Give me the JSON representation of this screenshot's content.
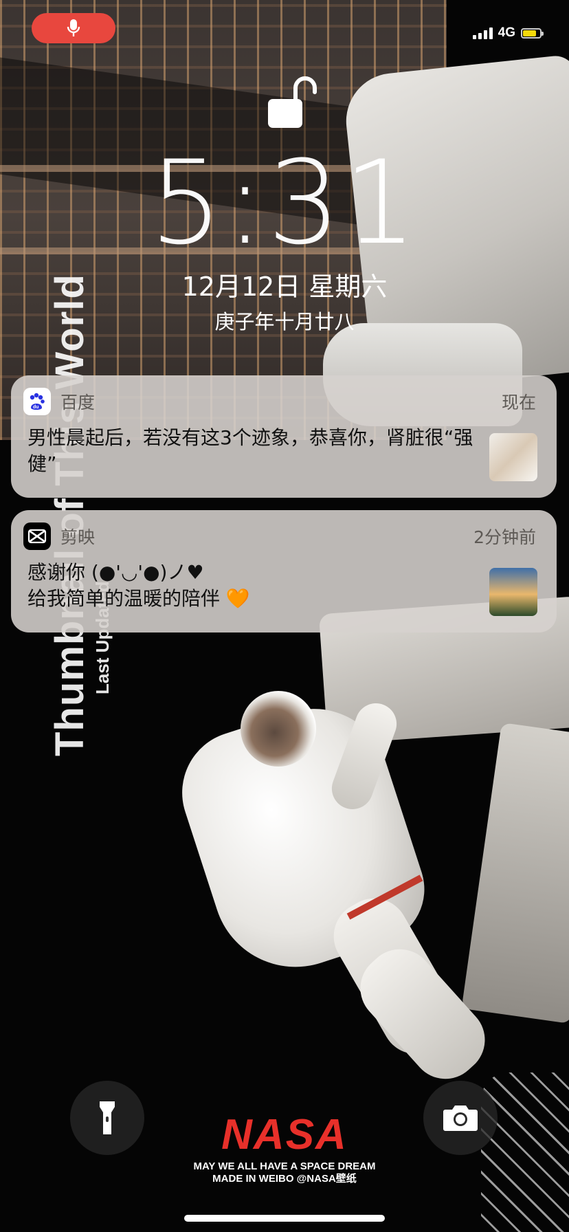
{
  "status_bar": {
    "mic_pill_color": "#e8473e",
    "mic_icon": "microphone-icon",
    "network": "4G",
    "signal_bars": 4,
    "battery_color": "#f5d90a",
    "battery_level": 0.8
  },
  "lock_screen": {
    "lock_icon": "unlocked-padlock-icon",
    "time": "5:31",
    "date": "12月12日 星期六",
    "lunar_date": "庚子年十月廿八"
  },
  "notifications": [
    {
      "app": "百度",
      "app_icon": "baidu-paw-icon",
      "app_icon_color": "#2932e1",
      "time": "现在",
      "body": "男性晨起后，若没有这3个迹象，恭喜你，肾脏很“强健”",
      "has_thumbnail": true
    },
    {
      "app": "剪映",
      "app_icon": "capcut-icon",
      "time": "2分钟前",
      "line1": "感谢你 (●'◡'●)ノ♥",
      "line2": "给我简单的温暖的陪伴 🧡",
      "has_thumbnail": true
    }
  ],
  "wallpaper": {
    "vertical_title": "Thumbnail of This World",
    "vertical_subtitle": "Last Updated",
    "brand": "NASA",
    "brand_color": "#e8302a",
    "tagline_1": "MAY WE ALL HAVE A SPACE DREAM",
    "tagline_2": "MADE IN WEIBO @NASA壁纸"
  },
  "quick_actions": {
    "flashlight_icon": "flashlight-icon",
    "camera_icon": "camera-icon"
  }
}
